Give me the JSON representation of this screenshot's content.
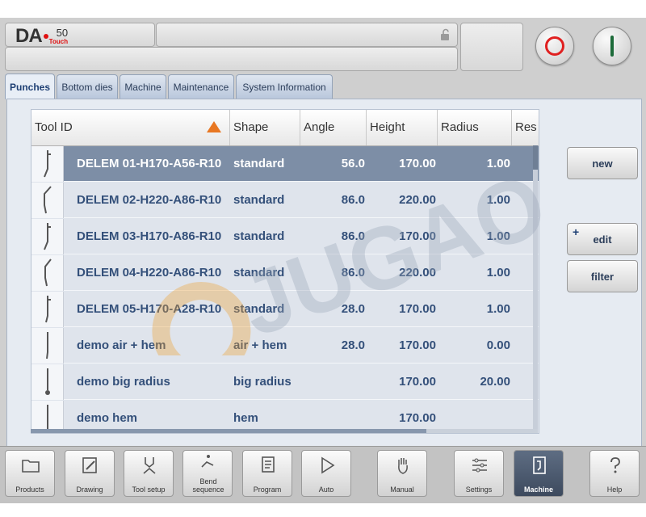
{
  "header": {
    "logo_brand": "DA",
    "logo_model": "50",
    "logo_touch": "Touch",
    "stop_button_icon": "stop-icon",
    "start_button_icon": "start-icon"
  },
  "tabs": [
    {
      "label": "Punches",
      "active": true
    },
    {
      "label": "Bottom dies"
    },
    {
      "label": "Machine"
    },
    {
      "label": "Maintenance"
    },
    {
      "label": "System Information"
    }
  ],
  "table": {
    "columns": [
      "Tool ID",
      "Shape",
      "Angle",
      "Height",
      "Radius",
      "Res"
    ],
    "sort_column": "Tool ID",
    "rows": [
      {
        "id": "DELEM 01-H170-A56-R10",
        "shape": "standard",
        "angle": "56.0",
        "height": "170.00",
        "radius": "1.00",
        "selected": true
      },
      {
        "id": "DELEM 02-H220-A86-R10",
        "shape": "standard",
        "angle": "86.0",
        "height": "220.00",
        "radius": "1.00"
      },
      {
        "id": "DELEM 03-H170-A86-R10",
        "shape": "standard",
        "angle": "86.0",
        "height": "170.00",
        "radius": "1.00"
      },
      {
        "id": "DELEM 04-H220-A86-R10",
        "shape": "standard",
        "angle": "86.0",
        "height": "220.00",
        "radius": "1.00"
      },
      {
        "id": "DELEM 05-H170-A28-R10",
        "shape": "standard",
        "angle": "28.0",
        "height": "170.00",
        "radius": "1.00"
      },
      {
        "id": "demo air + hem",
        "shape": "air + hem",
        "angle": "28.0",
        "height": "170.00",
        "radius": "0.00"
      },
      {
        "id": "demo big radius",
        "shape": "big radius",
        "angle": "",
        "height": "170.00",
        "radius": "20.00"
      },
      {
        "id": "demo hem",
        "shape": "hem",
        "angle": "",
        "height": "170.00",
        "radius": ""
      }
    ]
  },
  "side_buttons": {
    "new": "new",
    "edit": "edit",
    "edit_marker": "+",
    "filter": "filter"
  },
  "bottom_nav": [
    {
      "label": "Products",
      "icon": "folder-icon"
    },
    {
      "label": "Drawing",
      "icon": "drawing-icon"
    },
    {
      "label": "Tool setup",
      "icon": "tool-setup-icon"
    },
    {
      "label": "Bend sequence",
      "icon": "bend-sequence-icon"
    },
    {
      "label": "Program",
      "icon": "program-icon"
    },
    {
      "label": "Auto",
      "icon": "play-icon"
    },
    {
      "label": "Manual",
      "icon": "hand-icon"
    },
    {
      "label": "Settings",
      "icon": "settings-icon"
    },
    {
      "label": "Machine",
      "icon": "machine-icon",
      "active": true
    },
    {
      "label": "Help",
      "icon": "help-icon"
    }
  ],
  "watermark": "JUGAO",
  "colors": {
    "selected_row": "#7d8ea6",
    "row_text": "#34507a",
    "sort_indicator": "#e87722",
    "stop_red": "#e02020",
    "start_green": "#1d6b3a"
  }
}
